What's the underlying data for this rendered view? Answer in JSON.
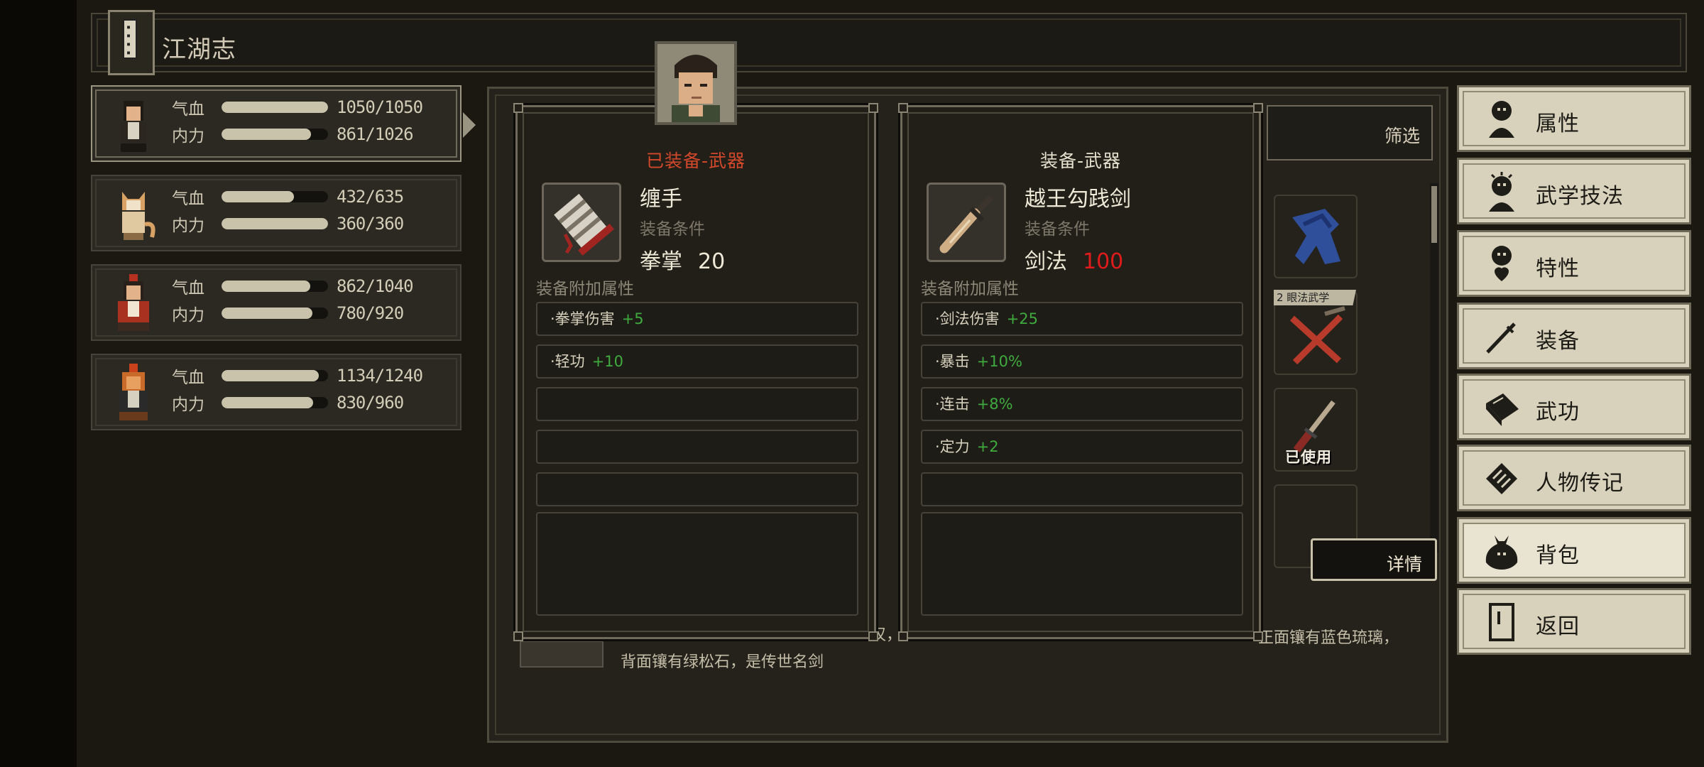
{
  "header": {
    "title": "江湖志"
  },
  "party": {
    "hp_label": "气血",
    "mp_label": "内力",
    "members": [
      {
        "hp": "1050/1050",
        "mp": "861/1026",
        "hp_ratio": 1.0,
        "mp_ratio": 0.84
      },
      {
        "hp": "432/635",
        "mp": "360/360",
        "hp_ratio": 0.68,
        "mp_ratio": 1.0
      },
      {
        "hp": "862/1040",
        "mp": "780/920",
        "hp_ratio": 0.83,
        "mp_ratio": 0.85
      },
      {
        "hp": "1134/1240",
        "mp": "830/960",
        "hp_ratio": 0.91,
        "mp_ratio": 0.86
      }
    ]
  },
  "inventory": {
    "filter_label": "筛选",
    "tag_text": "2 眼法武学",
    "used_text": "已使用",
    "detail_label": "详情",
    "desc_left": "背面镶有绿松石，是传世名剑",
    "desc_right": "正面镶有蓝色琉璃，",
    "desc_mid": "汉，"
  },
  "equipped": {
    "header": "已装备-武器",
    "name": "缠手",
    "cond_label": "装备条件",
    "req_skill": "拳掌",
    "req_value": "20",
    "bonus_header": "装备附加属性",
    "bonuses": [
      {
        "name": "·拳掌伤害",
        "value": "+5"
      },
      {
        "name": "·轻功",
        "value": "+10"
      }
    ]
  },
  "compare": {
    "header": "装备-武器",
    "name": "越王勾践剑",
    "cond_label": "装备条件",
    "req_skill": "剑法",
    "req_value": "100",
    "bonus_header": "装备附加属性",
    "bonuses": [
      {
        "name": "·剑法伤害",
        "value": "+25"
      },
      {
        "name": "·暴击",
        "value": "+10%"
      },
      {
        "name": "·连击",
        "value": "+8%"
      },
      {
        "name": "·定力",
        "value": "+2"
      }
    ]
  },
  "menu": {
    "items": [
      {
        "label": "属性",
        "icon": "person-icon"
      },
      {
        "label": "武学技法",
        "icon": "martial-arts-icon"
      },
      {
        "label": "特性",
        "icon": "trait-icon"
      },
      {
        "label": "装备",
        "icon": "sword-icon"
      },
      {
        "label": "武功",
        "icon": "book-icon"
      },
      {
        "label": "人物传记",
        "icon": "scroll-icon"
      },
      {
        "label": "背包",
        "icon": "bag-icon"
      },
      {
        "label": "返回",
        "icon": "door-icon"
      }
    ],
    "selected_index": 6
  },
  "colors": {
    "equipped_header": "#d2482a",
    "compare_header": "#e6e0ce",
    "bonus_plus": "#3fab3f",
    "req_insufficient": "#e01b1b",
    "menu_bg": "#d8d2bc"
  }
}
